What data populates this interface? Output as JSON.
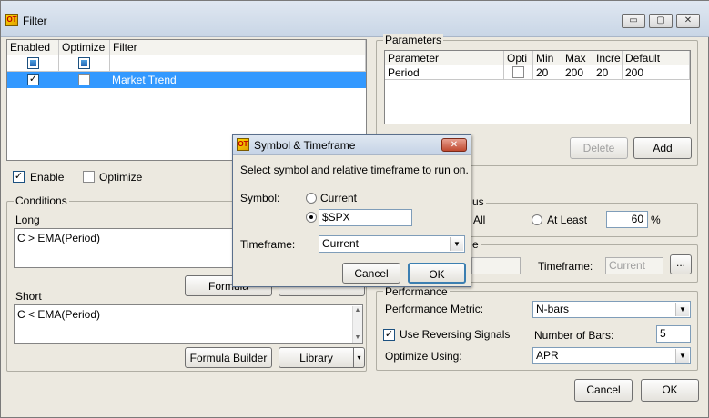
{
  "window": {
    "title": "Filter",
    "icon": "app-logo-icon",
    "minimize": "▭",
    "restore": "▢",
    "close": "✕"
  },
  "filter_table": {
    "headers": [
      "Enabled",
      "Optimize",
      "Filter"
    ],
    "rows": [
      {
        "enabled": true,
        "optimize": false,
        "filter": "Market Trend"
      }
    ],
    "selected_color": "#3399ff"
  },
  "enable_label": "Enable",
  "optimize_label": "Optimize",
  "parameters": {
    "title": "Parameters",
    "headers": [
      "Parameter",
      "Opti",
      "Min",
      "Max",
      "Incre",
      "Default"
    ],
    "rows": [
      {
        "parameter": "Period",
        "opti": false,
        "min": "20",
        "max": "200",
        "incre": "20",
        "default": "200"
      }
    ],
    "delete_label": "Delete",
    "add_label": "Add"
  },
  "conditions": {
    "title": "Conditions",
    "long_label": "Long",
    "long_value": "C > EMA(Period)",
    "short_label": "Short",
    "short_value": "C < EMA(Period)",
    "formula_builder_label": "Formula Builder",
    "library_label": "Library",
    "formula_partial": "Formula"
  },
  "consensus": {
    "title_partial": "us",
    "all_label": "All",
    "at_least_label": "At Least",
    "at_least_value": "60",
    "unit": "%"
  },
  "symbol_group": {
    "title_partial": "e",
    "timeframe_label": "Timeframe:",
    "timeframe_value": "Current",
    "browse_label": "..."
  },
  "performance": {
    "title": "Performance",
    "metric_label": "Performance Metric:",
    "metric_value": "N-bars",
    "reversing_label": "Use Reversing Signals",
    "reversing_checked": true,
    "bars_label": "Number of Bars:",
    "bars_value": "5",
    "optimize_label": "Optimize Using:",
    "optimize_value": "APR"
  },
  "footer": {
    "cancel_label": "Cancel",
    "ok_label": "OK"
  },
  "dialog": {
    "title": "Symbol & Timeframe",
    "instructions": "Select symbol and relative timeframe to run on.",
    "symbol_label": "Symbol:",
    "current_option": "Current",
    "symbol_value": "$SPX",
    "timeframe_label": "Timeframe:",
    "timeframe_value": "Current",
    "cancel_label": "Cancel",
    "ok_label": "OK"
  }
}
